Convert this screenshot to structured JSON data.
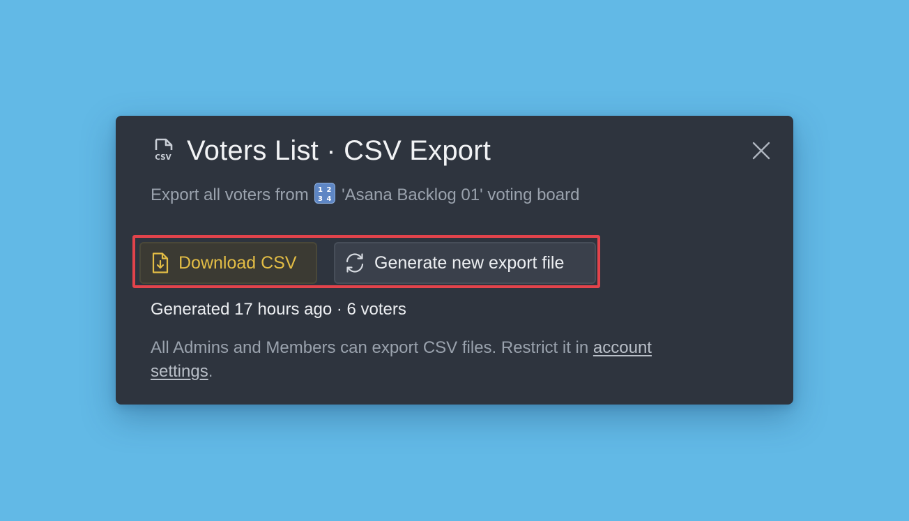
{
  "modal": {
    "title": "Voters List · CSV Export",
    "subtitle_prefix": "Export all voters from",
    "subtitle_emoji": "1234-emoji",
    "subtitle_suffix": "'Asana Backlog 01' voting board",
    "icons": {
      "file_type": "csv-file-icon",
      "close": "close-icon"
    }
  },
  "actions": {
    "download_label": "Download CSV",
    "download_icon": "file-download-icon",
    "generate_label": "Generate new export file",
    "generate_icon": "refresh-icon",
    "highlight_color": "#e2434b"
  },
  "status": {
    "generated_text": "Generated 17 hours ago · 6 voters"
  },
  "note": {
    "text": "All Admins and Members can export CSV files. Restrict it in",
    "link_text": "account settings",
    "suffix": "."
  },
  "colors": {
    "background": "#62b9e6",
    "modal_bg": "#2e343e",
    "download_accent": "#e3bd45"
  }
}
